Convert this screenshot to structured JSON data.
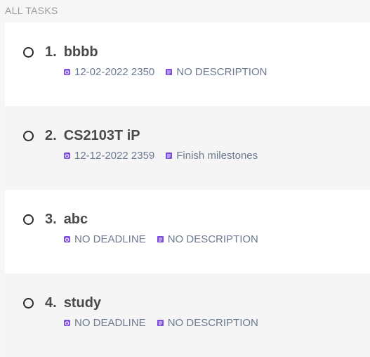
{
  "section": {
    "title": "ALL TASKS"
  },
  "colors": {
    "accent": "#7c4ddb",
    "meta_text": "#6b7a8f",
    "title_text": "#4a4a4a"
  },
  "tasks": [
    {
      "number": "1.",
      "name": "bbbb",
      "deadline": "12-02-2022 2350",
      "description": "NO DESCRIPTION",
      "deadline_icon": "clock-icon",
      "description_icon": "note-icon"
    },
    {
      "number": "2.",
      "name": "CS2103T iP",
      "deadline": "12-12-2022 2359",
      "description": "Finish milestones",
      "deadline_icon": "clock-icon",
      "description_icon": "note-icon"
    },
    {
      "number": "3.",
      "name": "abc",
      "deadline": "NO DEADLINE",
      "description": "NO DESCRIPTION",
      "deadline_icon": "clock-icon",
      "description_icon": "note-icon"
    },
    {
      "number": "4.",
      "name": "study",
      "deadline": "NO DEADLINE",
      "description": "NO DESCRIPTION",
      "deadline_icon": "clock-icon",
      "description_icon": "note-icon"
    }
  ]
}
